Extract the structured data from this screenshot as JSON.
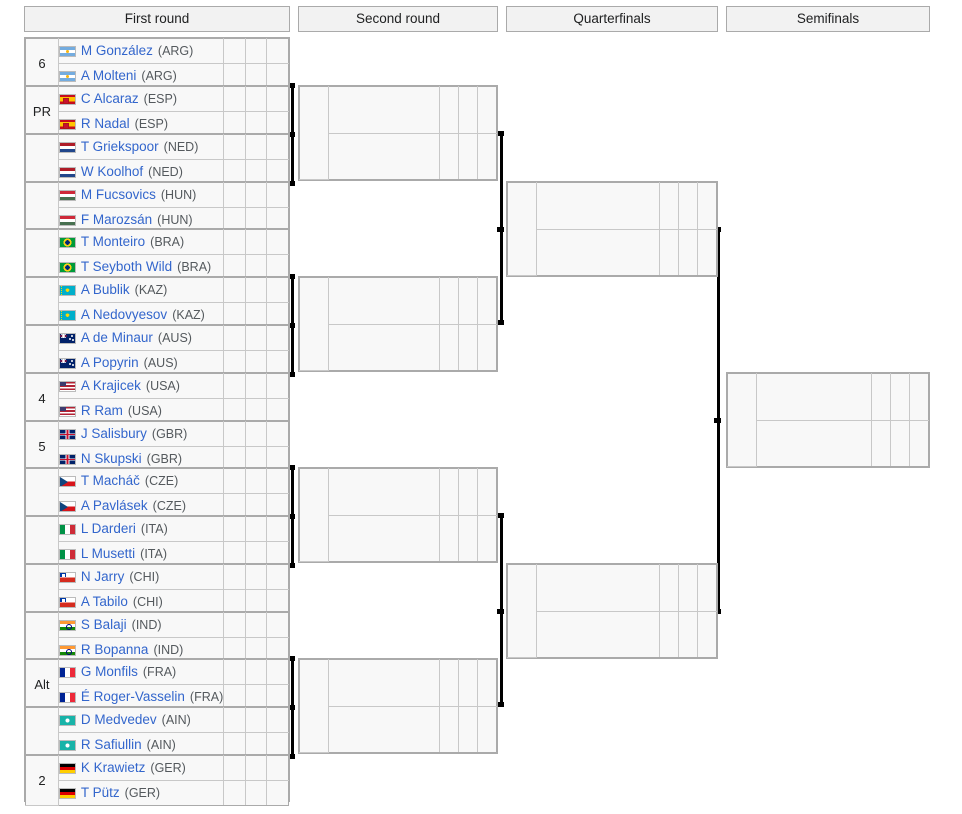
{
  "rounds": [
    {
      "id": "first-round",
      "label": "First round"
    },
    {
      "id": "second-round",
      "label": "Second round"
    },
    {
      "id": "quarterfinals",
      "label": "Quarterfinals"
    },
    {
      "id": "semifinals",
      "label": "Semifinals"
    }
  ],
  "colors": {
    "link": "#3366cc",
    "header_bg": "#f2f2f2",
    "cell_bg": "#f8f8f8",
    "seed_bg": "#f0f0f0",
    "border": "#aaaaaa",
    "inner_border": "#c8c8c8",
    "connector": "#000000"
  },
  "first_round": [
    {
      "seed": "6",
      "teams": [
        {
          "name": "M González",
          "country": "ARG",
          "flag": "flag-arg"
        },
        {
          "name": "A Molteni",
          "country": "ARG",
          "flag": "flag-arg"
        }
      ],
      "scores": [
        [
          "",
          "",
          ""
        ],
        [
          "",
          "",
          ""
        ]
      ]
    },
    {
      "seed": "PR",
      "teams": [
        {
          "name": "C Alcaraz",
          "country": "ESP",
          "flag": "flag-esp"
        },
        {
          "name": "R Nadal",
          "country": "ESP",
          "flag": "flag-esp"
        }
      ],
      "scores": [
        [
          "",
          "",
          ""
        ],
        [
          "",
          "",
          ""
        ]
      ]
    },
    {
      "seed": "",
      "teams": [
        {
          "name": "T Griekspoor",
          "country": "NED",
          "flag": "flag-ned"
        },
        {
          "name": "W Koolhof",
          "country": "NED",
          "flag": "flag-ned"
        }
      ],
      "scores": [
        [
          "",
          "",
          ""
        ],
        [
          "",
          "",
          ""
        ]
      ]
    },
    {
      "seed": "",
      "teams": [
        {
          "name": "M Fucsovics",
          "country": "HUN",
          "flag": "flag-hun"
        },
        {
          "name": "F Marozsán",
          "country": "HUN",
          "flag": "flag-hun"
        }
      ],
      "scores": [
        [
          "",
          "",
          ""
        ],
        [
          "",
          "",
          ""
        ]
      ]
    },
    {
      "seed": "",
      "teams": [
        {
          "name": "T Monteiro",
          "country": "BRA",
          "flag": "flag-bra"
        },
        {
          "name": "T Seyboth Wild",
          "country": "BRA",
          "flag": "flag-bra"
        }
      ],
      "scores": [
        [
          "",
          "",
          ""
        ],
        [
          "",
          "",
          ""
        ]
      ]
    },
    {
      "seed": "",
      "teams": [
        {
          "name": "A Bublik",
          "country": "KAZ",
          "flag": "flag-kaz"
        },
        {
          "name": "A Nedovyesov",
          "country": "KAZ",
          "flag": "flag-kaz"
        }
      ],
      "scores": [
        [
          "",
          "",
          ""
        ],
        [
          "",
          "",
          ""
        ]
      ]
    },
    {
      "seed": "",
      "teams": [
        {
          "name": "A de Minaur",
          "country": "AUS",
          "flag": "flag-aus"
        },
        {
          "name": "A Popyrin",
          "country": "AUS",
          "flag": "flag-aus"
        }
      ],
      "scores": [
        [
          "",
          "",
          ""
        ],
        [
          "",
          "",
          ""
        ]
      ]
    },
    {
      "seed": "4",
      "teams": [
        {
          "name": "A Krajicek",
          "country": "USA",
          "flag": "flag-usa"
        },
        {
          "name": "R Ram",
          "country": "USA",
          "flag": "flag-usa"
        }
      ],
      "scores": [
        [
          "",
          "",
          ""
        ],
        [
          "",
          "",
          ""
        ]
      ]
    },
    {
      "seed": "5",
      "teams": [
        {
          "name": "J Salisbury",
          "country": "GBR",
          "flag": "flag-gbr"
        },
        {
          "name": "N Skupski",
          "country": "GBR",
          "flag": "flag-gbr"
        }
      ],
      "scores": [
        [
          "",
          "",
          ""
        ],
        [
          "",
          "",
          ""
        ]
      ]
    },
    {
      "seed": "",
      "teams": [
        {
          "name": "T Macháč",
          "country": "CZE",
          "flag": "flag-cze"
        },
        {
          "name": "A Pavlásek",
          "country": "CZE",
          "flag": "flag-cze"
        }
      ],
      "scores": [
        [
          "",
          "",
          ""
        ],
        [
          "",
          "",
          ""
        ]
      ]
    },
    {
      "seed": "",
      "teams": [
        {
          "name": "L Darderi",
          "country": "ITA",
          "flag": "flag-ita"
        },
        {
          "name": "L Musetti",
          "country": "ITA",
          "flag": "flag-ita"
        }
      ],
      "scores": [
        [
          "",
          "",
          ""
        ],
        [
          "",
          "",
          ""
        ]
      ]
    },
    {
      "seed": "",
      "teams": [
        {
          "name": "N Jarry",
          "country": "CHI",
          "flag": "flag-chi"
        },
        {
          "name": "A Tabilo",
          "country": "CHI",
          "flag": "flag-chi"
        }
      ],
      "scores": [
        [
          "",
          "",
          ""
        ],
        [
          "",
          "",
          ""
        ]
      ]
    },
    {
      "seed": "",
      "teams": [
        {
          "name": "S Balaji",
          "country": "IND",
          "flag": "flag-ind"
        },
        {
          "name": "R Bopanna",
          "country": "IND",
          "flag": "flag-ind"
        }
      ],
      "scores": [
        [
          "",
          "",
          ""
        ],
        [
          "",
          "",
          ""
        ]
      ]
    },
    {
      "seed": "Alt",
      "teams": [
        {
          "name": "G Monfils",
          "country": "FRA",
          "flag": "flag-fra"
        },
        {
          "name": "É Roger-Vasselin",
          "country": "FRA",
          "flag": "flag-fra"
        }
      ],
      "scores": [
        [
          "",
          "",
          ""
        ],
        [
          "",
          "",
          ""
        ]
      ]
    },
    {
      "seed": "",
      "teams": [
        {
          "name": "D Medvedev",
          "country": "AIN",
          "flag": "flag-ain"
        },
        {
          "name": "R Safiullin",
          "country": "AIN",
          "flag": "flag-ain"
        }
      ],
      "scores": [
        [
          "",
          "",
          ""
        ],
        [
          "",
          "",
          ""
        ]
      ]
    },
    {
      "seed": "2",
      "teams": [
        {
          "name": "K Krawietz",
          "country": "GER",
          "flag": "flag-ger"
        },
        {
          "name": "T Pütz",
          "country": "GER",
          "flag": "flag-ger"
        }
      ],
      "scores": [
        [
          "",
          "",
          ""
        ],
        [
          "",
          "",
          ""
        ]
      ]
    }
  ],
  "second_round": [
    {
      "seed": "",
      "teams": [
        {
          "name": "",
          "country": "",
          "flag": ""
        },
        {
          "name": "",
          "country": "",
          "flag": ""
        }
      ],
      "scores": [
        [
          "",
          "",
          ""
        ],
        [
          "",
          "",
          ""
        ]
      ]
    },
    {
      "seed": "",
      "teams": [
        {
          "name": "",
          "country": "",
          "flag": ""
        },
        {
          "name": "",
          "country": "",
          "flag": ""
        }
      ],
      "scores": [
        [
          "",
          "",
          ""
        ],
        [
          "",
          "",
          ""
        ]
      ]
    },
    {
      "seed": "",
      "teams": [
        {
          "name": "",
          "country": "",
          "flag": ""
        },
        {
          "name": "",
          "country": "",
          "flag": ""
        }
      ],
      "scores": [
        [
          "",
          "",
          ""
        ],
        [
          "",
          "",
          ""
        ]
      ]
    },
    {
      "seed": "",
      "teams": [
        {
          "name": "",
          "country": "",
          "flag": ""
        },
        {
          "name": "",
          "country": "",
          "flag": ""
        }
      ],
      "scores": [
        [
          "",
          "",
          ""
        ],
        [
          "",
          "",
          ""
        ]
      ]
    }
  ],
  "quarterfinals": [
    {
      "seed": "",
      "teams": [
        {
          "name": "",
          "country": "",
          "flag": ""
        },
        {
          "name": "",
          "country": "",
          "flag": ""
        }
      ],
      "scores": [
        [
          "",
          "",
          ""
        ],
        [
          "",
          "",
          ""
        ]
      ]
    },
    {
      "seed": "",
      "teams": [
        {
          "name": "",
          "country": "",
          "flag": ""
        },
        {
          "name": "",
          "country": "",
          "flag": ""
        }
      ],
      "scores": [
        [
          "",
          "",
          ""
        ],
        [
          "",
          "",
          ""
        ]
      ]
    }
  ],
  "semifinals": [
    {
      "seed": "",
      "teams": [
        {
          "name": "",
          "country": "",
          "flag": ""
        },
        {
          "name": "",
          "country": "",
          "flag": ""
        }
      ],
      "scores": [
        [
          "",
          "",
          ""
        ],
        [
          "",
          "",
          ""
        ]
      ]
    }
  ]
}
